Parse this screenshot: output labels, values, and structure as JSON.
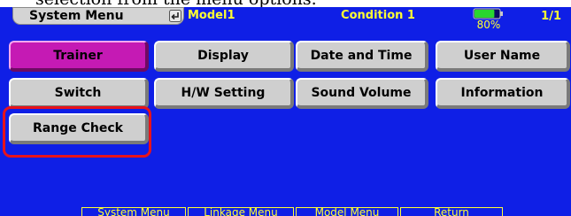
{
  "caption": {
    "text": "selection from the menu options."
  },
  "header": {
    "menu_title": "System Menu",
    "back_icon": "return-arrow-icon",
    "model_name": "Model1",
    "condition": "Condition 1",
    "battery_percent": "80%",
    "battery_level": 0.8,
    "page_indicator": "1/1"
  },
  "menu": {
    "row1": [
      {
        "label": "Trainer",
        "active": true
      },
      {
        "label": "Display",
        "active": false
      },
      {
        "label": "Date and Time",
        "active": false
      },
      {
        "label": "User Name",
        "active": false
      }
    ],
    "row2": [
      {
        "label": "Switch"
      },
      {
        "label": "H/W Setting"
      },
      {
        "label": "Sound Volume"
      },
      {
        "label": "Information"
      }
    ],
    "row3": [
      {
        "label": "Range Check",
        "highlighted": true
      }
    ]
  },
  "footer": {
    "tabs": [
      {
        "label": "System Menu"
      },
      {
        "label": "Linkage Menu"
      },
      {
        "label": "Model Menu"
      },
      {
        "label": "Return"
      }
    ]
  },
  "colors": {
    "screen_bg": "#0f1fe6",
    "accent_text": "#ffff33",
    "active_button": "#c51ab4",
    "highlight_ring": "#e8131b",
    "battery_fill": "#29d62f"
  }
}
